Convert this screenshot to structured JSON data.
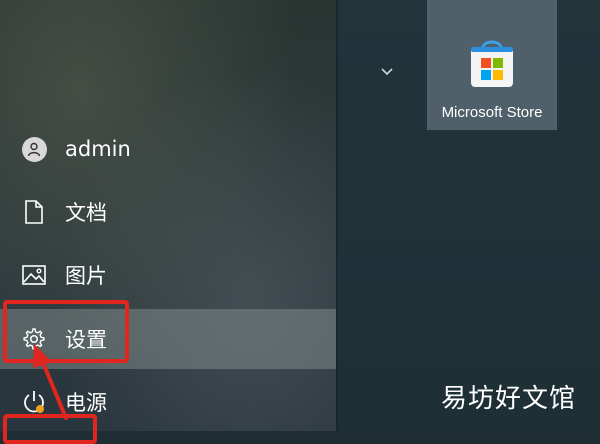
{
  "start_menu": {
    "user": {
      "name": "admin",
      "icon": "user-avatar-icon"
    },
    "items": [
      {
        "label": "文档",
        "icon": "document-icon"
      },
      {
        "label": "图片",
        "icon": "picture-icon"
      },
      {
        "label": "设置",
        "icon": "gear-icon"
      },
      {
        "label": "电源",
        "icon": "power-icon"
      }
    ],
    "active_item": "设置"
  },
  "pinned": {
    "tiles": [
      {
        "label": "Microsoft Store",
        "icon": "microsoft-store-icon"
      }
    ]
  },
  "watermark": "易坊好文馆",
  "colors": {
    "highlight": "#e0261f",
    "tile": "#4f606a",
    "store_bag": "#0078d4"
  }
}
